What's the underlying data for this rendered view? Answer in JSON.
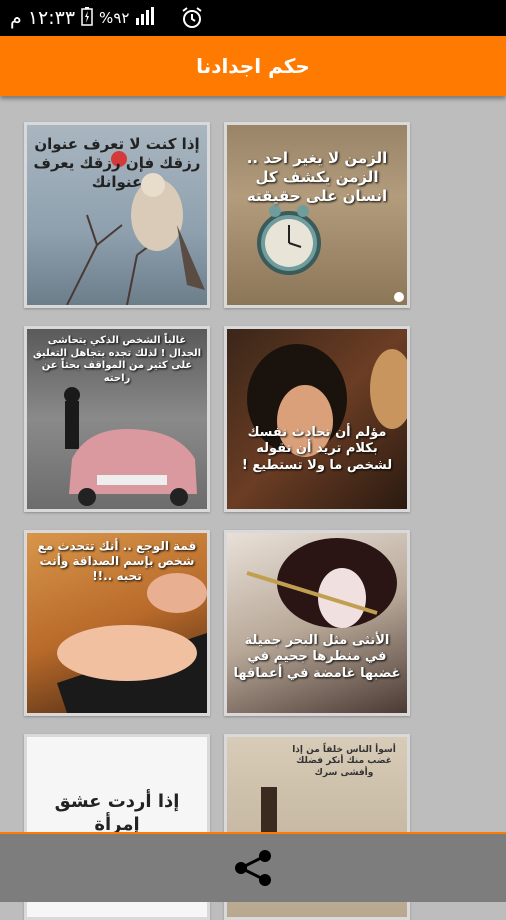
{
  "status_bar": {
    "time": "١٢:٣٣ م",
    "battery_percent": "%٩٢",
    "icons": [
      "battery-icon",
      "signal-icon",
      "alarm-icon"
    ]
  },
  "app_bar": {
    "title": "حكم اجدادنا"
  },
  "cards": [
    {
      "caption": "الزمن لا يغير احد .. الزمن يكشف كل انسان على حقيقته"
    },
    {
      "caption": "إذا كنت لا تعرف عنوان رزقك فإن رزقك يعرف عنوانك"
    },
    {
      "caption": "مؤلم أن تحادث نفسك بكلام تريد أن تقوله لشخص ما ولا تستطيع !"
    },
    {
      "caption": "غالباً الشخص الذكي يتحاشى الجدال ! لذلك تجده يتجاهل التعليق على كثير من المواقف بحثاً عن راحته"
    },
    {
      "caption": "الأنثى مثل البحر جميلة في منظرها جحيم في غضبها غامضة في أعماقها"
    },
    {
      "caption": "قمة الوجع .. أنك تتحدث مع شخص بإسم الصداقة وأنت تحبه ..!!"
    },
    {
      "caption": "أسوأ الناس خلقاً من إذا غضب منك أنكر فضلك وأفشى سرك"
    },
    {
      "caption": "إذا أردت عشق إمرأة"
    }
  ],
  "colors": {
    "accent": "#ff7a00",
    "background": "#bdbdbd",
    "bottom_bar": "#7d7d7d"
  },
  "bottom_bar": {
    "share_icon": "share-icon"
  }
}
